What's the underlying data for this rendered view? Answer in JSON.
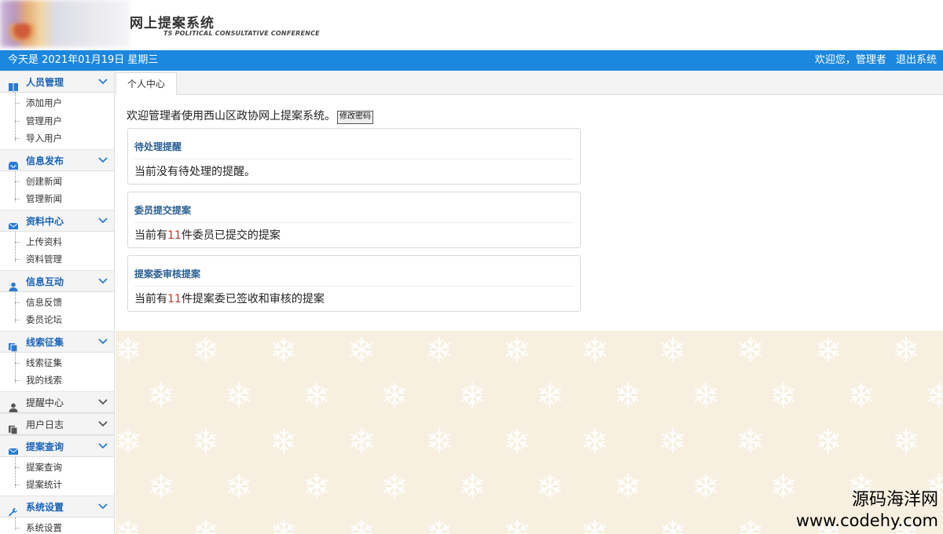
{
  "header": {
    "title": "网上提案系统",
    "subtitle": "TS POLITICAL CONSULTATIVE CONFERENCE"
  },
  "topbar": {
    "date_text": "今天是 2021年01月19日 星期三",
    "welcome_text": "欢迎您，管理者",
    "logout_label": "退出系统"
  },
  "sidebar": {
    "groups": [
      {
        "label": "人员管理",
        "icon": "book-icon",
        "items": [
          "添加用户",
          "管理用户",
          "导入用户"
        ]
      },
      {
        "label": "信息发布",
        "icon": "inbox-icon",
        "items": [
          "创建新闻",
          "管理新闻"
        ]
      },
      {
        "label": "资料中心",
        "icon": "mail-icon",
        "items": [
          "上传资料",
          "资料管理"
        ]
      },
      {
        "label": "信息互动",
        "icon": "user-icon",
        "items": [
          "信息反馈",
          "委员论坛"
        ]
      },
      {
        "label": "线索征集",
        "icon": "copy-icon",
        "items": [
          "线索征集",
          "我的线索"
        ]
      },
      {
        "label": "提醒中心",
        "icon": "user-icon",
        "items": []
      },
      {
        "label": "用户日志",
        "icon": "copy-icon",
        "items": []
      },
      {
        "label": "提案查询",
        "icon": "mail-icon",
        "items": [
          "提案查询",
          "提案统计"
        ]
      },
      {
        "label": "系统设置",
        "icon": "wrench-icon",
        "items": [
          "系统设置"
        ]
      }
    ]
  },
  "tabs": {
    "active_label": "个人中心"
  },
  "content": {
    "welcome": "欢迎管理者使用西山区政协网上提案系统。",
    "change_password_label": "修改密码",
    "cards": [
      {
        "title": "待处理提醒",
        "text_pre": "当前没有待处理的提醒。",
        "count": "",
        "text_post": ""
      },
      {
        "title": "委员提交提案",
        "text_pre": "当前有",
        "count": "11",
        "text_post": "件委员已提交的提案"
      },
      {
        "title": "提案委审核提案",
        "text_pre": "当前有",
        "count": "11",
        "text_post": "件提案委已签收和审核的提案"
      }
    ]
  },
  "watermark": {
    "cn": "源码海洋网",
    "url": "www.codehy.com"
  },
  "colors": {
    "topbar": "#1c87df",
    "sidebar_group_text": "#1a63b8",
    "card_title": "#2a5f93",
    "count_highlight": "#c0392b",
    "background": "#f7efe0"
  }
}
